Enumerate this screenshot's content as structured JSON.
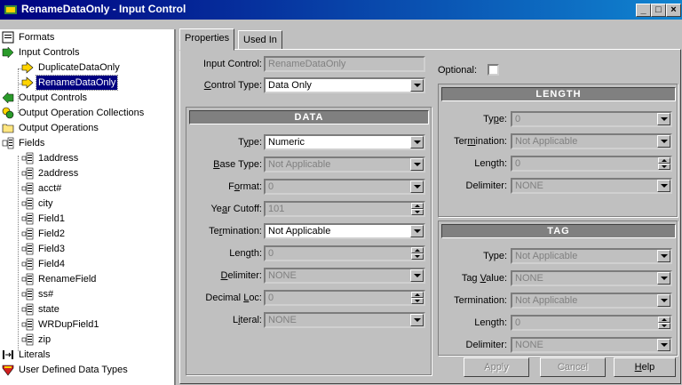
{
  "window": {
    "title": "RenameDataOnly - Input Control",
    "controls": {
      "minimize": "_",
      "maximize": "□",
      "close": "×"
    }
  },
  "tree": {
    "items": [
      {
        "label": "Formats",
        "icon": "formats-icon"
      },
      {
        "label": "Input Controls",
        "icon": "input-controls-icon"
      },
      {
        "label": "DuplicateDataOnly",
        "icon": "input-control-icon"
      },
      {
        "label": "RenameDataOnly",
        "icon": "input-control-icon"
      },
      {
        "label": "Output Controls",
        "icon": "output-controls-icon"
      },
      {
        "label": "Output Operation Collections",
        "icon": "collections-icon"
      },
      {
        "label": "Output Operations",
        "icon": "folder-icon"
      },
      {
        "label": "Fields",
        "icon": "fields-icon"
      },
      {
        "label": "1address",
        "icon": "field-icon"
      },
      {
        "label": "2address",
        "icon": "field-icon"
      },
      {
        "label": "acct#",
        "icon": "field-icon"
      },
      {
        "label": "city",
        "icon": "field-icon"
      },
      {
        "label": "Field1",
        "icon": "field-icon"
      },
      {
        "label": "Field2",
        "icon": "field-icon"
      },
      {
        "label": "Field3",
        "icon": "field-icon"
      },
      {
        "label": "Field4",
        "icon": "field-icon"
      },
      {
        "label": "RenameField",
        "icon": "field-icon"
      },
      {
        "label": "ss#",
        "icon": "field-icon"
      },
      {
        "label": "state",
        "icon": "field-icon"
      },
      {
        "label": "WRDupField1",
        "icon": "field-icon"
      },
      {
        "label": "zip",
        "icon": "field-icon"
      },
      {
        "label": "Literals",
        "icon": "literals-icon"
      },
      {
        "label": "User Defined Data Types",
        "icon": "user-types-icon"
      }
    ],
    "selected": "RenameDataOnly"
  },
  "tabs": [
    {
      "label": "Properties",
      "active": true
    },
    {
      "label": "Used In",
      "active": false
    }
  ],
  "properties": {
    "input_control": {
      "label": "Input Control:",
      "value": "RenameDataOnly"
    },
    "control_type": {
      "label_pre": "",
      "label_u": "C",
      "label_post": "ontrol Type:",
      "value": "Data Only"
    },
    "optional": {
      "label": "Optional:",
      "checked": false
    },
    "data": {
      "header": "DATA",
      "type": {
        "label_pre": "T",
        "label_u": "y",
        "label_post": "pe:",
        "value": "Numeric"
      },
      "base_type": {
        "label_pre": "",
        "label_u": "B",
        "label_post": "ase Type:",
        "value": "Not Applicable"
      },
      "format": {
        "label_pre": "F",
        "label_u": "o",
        "label_post": "rmat:",
        "value": "0"
      },
      "year_cutoff": {
        "label_pre": "Ye",
        "label_u": "a",
        "label_post": "r Cutoff:",
        "value": "101"
      },
      "termination": {
        "label_pre": "Te",
        "label_u": "r",
        "label_post": "mination:",
        "value": "Not Applicable"
      },
      "length": {
        "label_pre": "Len",
        "label_u": "g",
        "label_post": "th:",
        "value": "0"
      },
      "delimiter": {
        "label_pre": "",
        "label_u": "D",
        "label_post": "elimiter:",
        "value": "NONE"
      },
      "decimal_loc": {
        "label_pre": "Decimal ",
        "label_u": "L",
        "label_post": "oc:",
        "value": "0"
      },
      "literal": {
        "label_pre": "L",
        "label_u": "i",
        "label_post": "teral:",
        "value": "NONE"
      }
    },
    "length_section": {
      "header": "LENGTH",
      "type": {
        "label_pre": "Ty",
        "label_u": "p",
        "label_post": "e:",
        "value": "0"
      },
      "termination": {
        "label_pre": "Ter",
        "label_u": "m",
        "label_post": "ination:",
        "value": "Not Applicable"
      },
      "length": {
        "label": "Length:",
        "value": "0"
      },
      "delimiter": {
        "label": "Delimiter:",
        "value": "NONE"
      }
    },
    "tag_section": {
      "header": "TAG",
      "type": {
        "label": "Type:",
        "value": "Not Applicable"
      },
      "tag_value": {
        "label_pre": "Tag ",
        "label_u": "V",
        "label_post": "alue:",
        "value": "NONE"
      },
      "termination": {
        "label": "Termination:",
        "value": "Not Applicable"
      },
      "length": {
        "label": "Length:",
        "value": "0"
      },
      "delimiter": {
        "label": "Delimiter:",
        "value": "NONE"
      }
    }
  },
  "buttons": {
    "apply": "Apply",
    "cancel": "Cancel",
    "help_u": "H",
    "help_post": "elp"
  }
}
